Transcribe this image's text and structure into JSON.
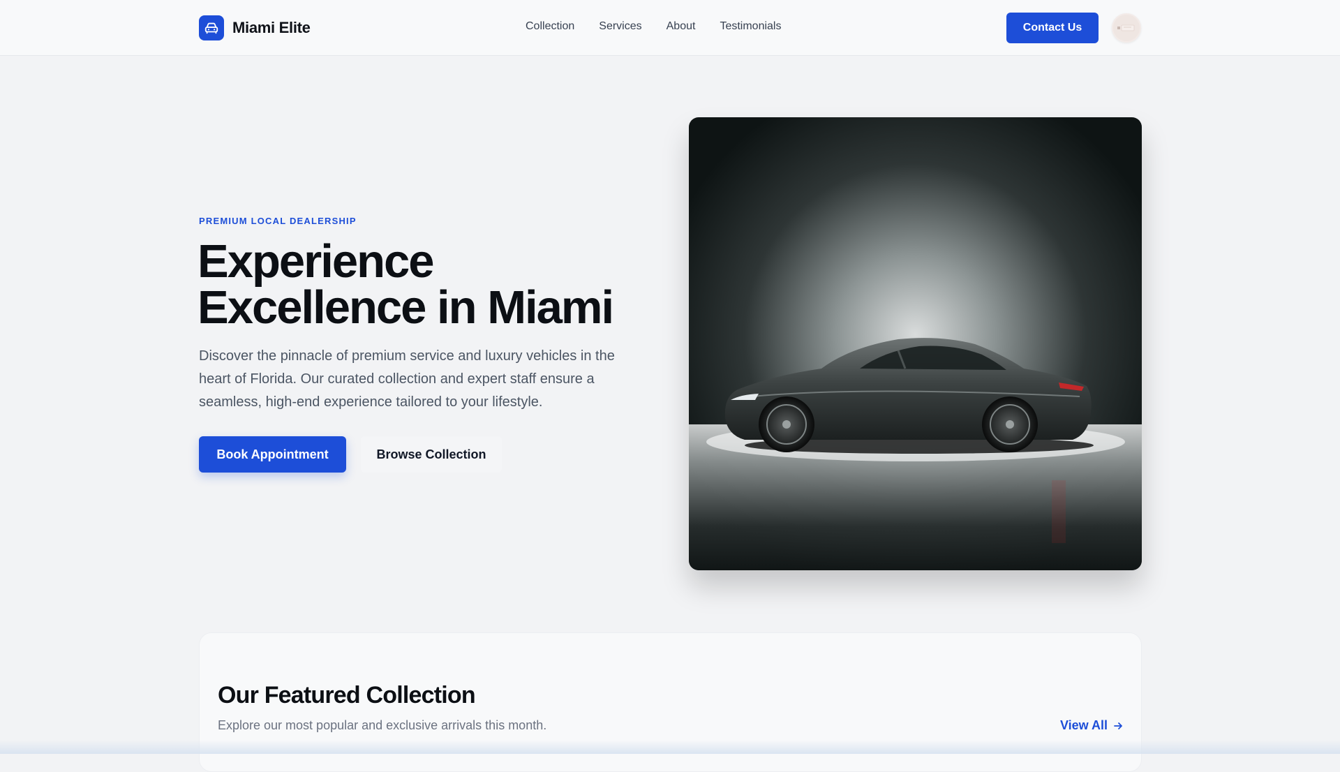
{
  "brand": {
    "name": "Miami Elite",
    "icon": "car-icon"
  },
  "nav": {
    "links": [
      "Collection",
      "Services",
      "About",
      "Testimonials"
    ],
    "contact_label": "Contact Us"
  },
  "hero": {
    "eyebrow": "PREMIUM LOCAL DEALERSHIP",
    "title_line1": "Experience",
    "title_line2": "Excellence in Miami",
    "description": "Discover the pinnacle of premium service and luxury vehicles in the heart of Florida. Our curated collection and expert staff ensure a seamless, high-end experience tailored to your lifestyle.",
    "primary_cta": "Book Appointment",
    "secondary_cta": "Browse Collection"
  },
  "featured": {
    "title": "Our Featured Collection",
    "subtitle": "Explore our most popular and exclusive arrivals this month.",
    "view_all": "View All"
  },
  "colors": {
    "accent": "#1d4ed8",
    "text_dark": "#0c0f14",
    "text_muted": "#4b5563",
    "background": "#f2f3f5"
  }
}
